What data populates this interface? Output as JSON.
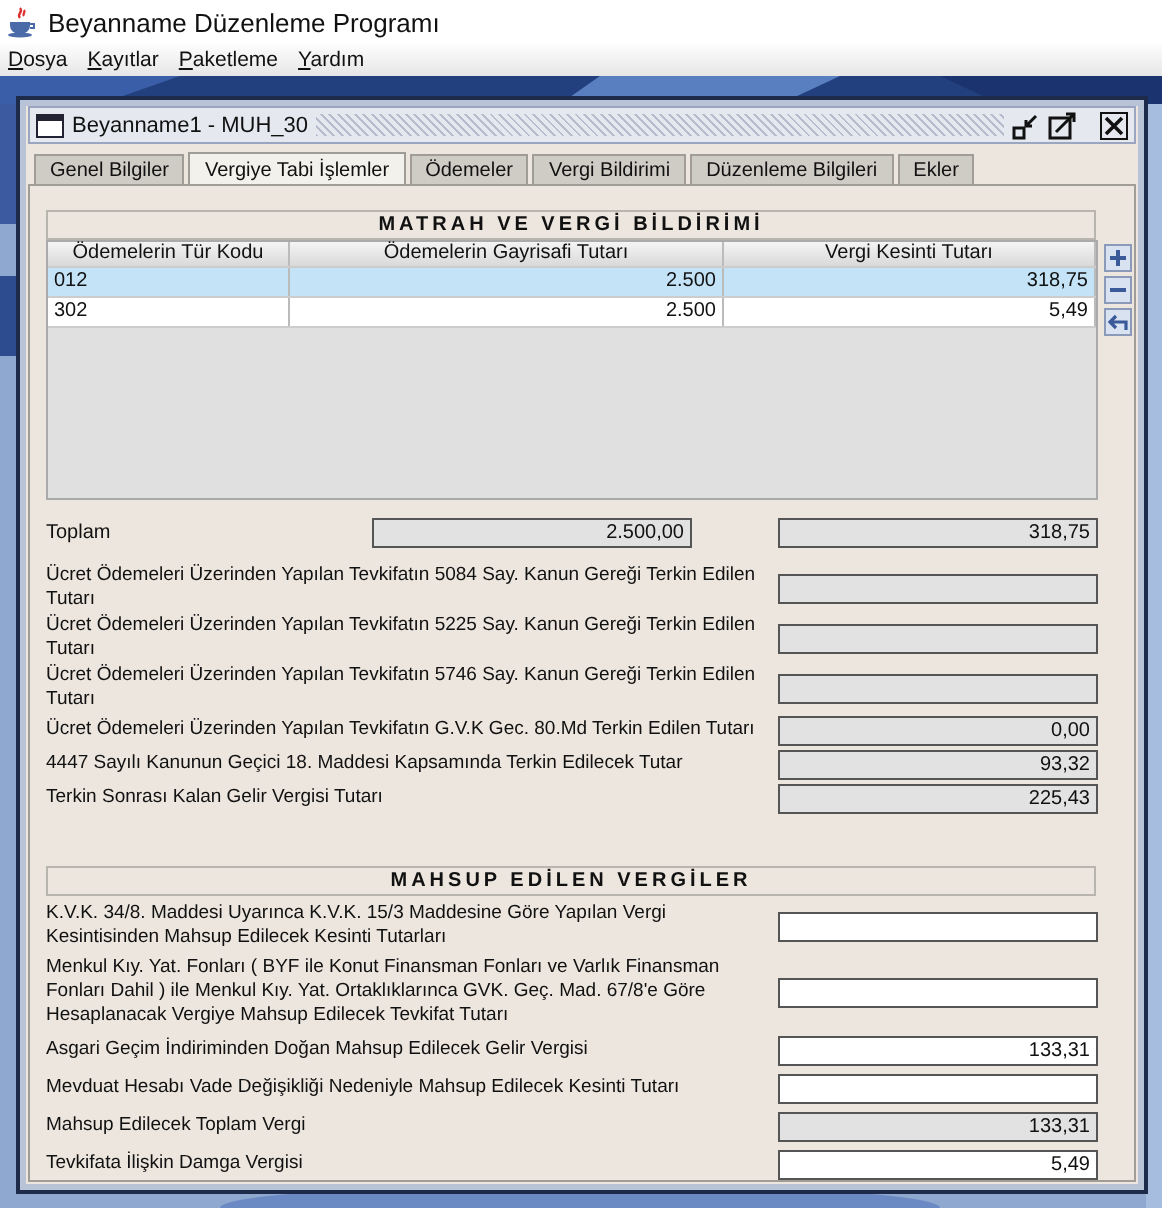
{
  "app": {
    "title": "Beyanname Düzenleme Programı"
  },
  "menu": [
    "Dosya",
    "Kayıtlar",
    "Paketleme",
    "Yardım"
  ],
  "window": {
    "title": "Beyanname1 - MUH_30"
  },
  "tabs": [
    {
      "label": "Genel Bilgiler",
      "selected": false
    },
    {
      "label": "Vergiye Tabi İşlemler",
      "selected": true
    },
    {
      "label": "Ödemeler",
      "selected": false
    },
    {
      "label": "Vergi Bildirimi",
      "selected": false
    },
    {
      "label": "Düzenleme Bilgileri",
      "selected": false
    },
    {
      "label": "Ekler",
      "selected": false
    }
  ],
  "matrah": {
    "heading": "MATRAH VE VERGİ BİLDİRİMİ",
    "table": {
      "columns": [
        "Ödemelerin Tür Kodu",
        "Ödemelerin Gayrisafi Tutarı",
        "Vergi Kesinti Tutarı"
      ],
      "rows": [
        {
          "cells": [
            "012",
            "2.500",
            "318,75"
          ],
          "selected": true
        },
        {
          "cells": [
            "302",
            "2.500",
            "5,49"
          ],
          "selected": false
        }
      ]
    },
    "total": {
      "label": "Toplam",
      "gross": "2.500,00",
      "tax": "318,75"
    },
    "lines": [
      {
        "label": "Ücret Ödemeleri Üzerinden Yapılan Tevkifatın 5084 Say. Kanun Gereği Terkin Edilen Tutarı",
        "readonly": true
      },
      {
        "label": "Ücret Ödemeleri Üzerinden Yapılan Tevkifatın 5225 Say. Kanun Gereği Terkin Edilen Tutarı",
        "readonly": true
      },
      {
        "label": "Ücret Ödemeleri Üzerinden Yapılan Tevkifatın 5746 Say. Kanun Gereği Terkin Edilen Tutarı",
        "readonly": true
      },
      {
        "label": "Ücret Ödemeleri Üzerinden Yapılan Tevkifatın G.V.K Gec. 80.Md Terkin Edilen Tutarı",
        "value": "0,00",
        "readonly": true
      },
      {
        "label": "4447 Sayılı Kanunun Geçici 18. Maddesi Kapsamında Terkin Edilecek Tutar",
        "value": "93,32",
        "readonly": true
      },
      {
        "label": "Terkin Sonrası Kalan Gelir Vergisi Tutarı",
        "value": "225,43",
        "readonly": true
      }
    ]
  },
  "mahsup": {
    "heading": "MAHSUP EDİLEN VERGİLER",
    "lines": [
      {
        "label": "K.V.K. 34/8. Maddesi Uyarınca K.V.K. 15/3 Maddesine Göre Yapılan Vergi Kesintisinden Mahsup Edilecek Kesinti Tutarları",
        "readonly": false
      },
      {
        "label": "Menkul Kıy. Yat. Fonları ( BYF ile Konut Finansman Fonları ve Varlık Finansman Fonları Dahil ) ile Menkul Kıy. Yat. Ortaklıklarınca GVK. Geç. Mad. 67/8'e Göre Hesaplanacak Vergiye Mahsup Edilecek Tevkifat Tutarı",
        "readonly": false
      },
      {
        "label": "Asgari Geçim İndiriminden Doğan Mahsup Edilecek Gelir Vergisi",
        "value": "133,31",
        "readonly": false
      },
      {
        "label": "Mevduat Hesabı Vade Değişikliği Nedeniyle Mahsup Edilecek Kesinti Tutarı",
        "readonly": false
      },
      {
        "label": "Mahsup Edilecek Toplam Vergi",
        "value": "133,31",
        "readonly": true
      },
      {
        "label": "Tevkifata İlişkin Damga Vergisi",
        "value": "5,49",
        "readonly": false
      }
    ]
  }
}
